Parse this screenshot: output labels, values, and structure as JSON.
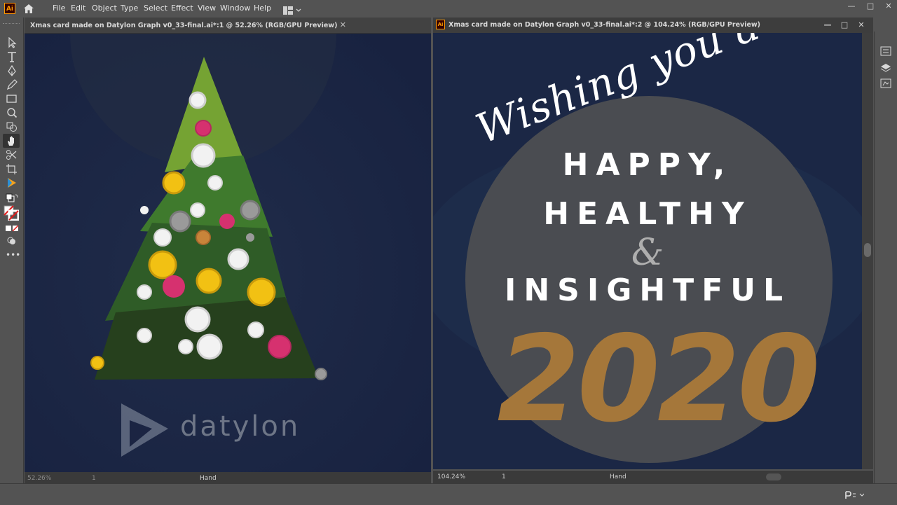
{
  "app": {
    "logo_text": "Ai"
  },
  "menu": [
    "File",
    "Edit",
    "Object",
    "Type",
    "Select",
    "Effect",
    "View",
    "Window",
    "Help"
  ],
  "window_controls": {
    "minimize": "—",
    "maximize": "□",
    "close": "✕"
  },
  "doc_left": {
    "tab_title": "Xmas card made on Datylon Graph v0_33-final.ai*:1 @ 52.26% (RGB/GPU Preview)",
    "close": "✕",
    "zoom": "52.26%",
    "page": "1",
    "tool_status": "Hand",
    "logo_word": "datylon"
  },
  "doc_right": {
    "tab_title": "Xmas card made on Datylon Graph v0_33-final.ai*:2 @ 104.24% (RGB/GPU Preview)",
    "zoom": "104.24%",
    "page": "1",
    "tool_status": "Hand",
    "script_line": "Wishing you a",
    "line1": "HAPPY,",
    "line2": "HEALTHY",
    "ampersand": "&",
    "line3": "INSIGHTFUL",
    "year": "2020"
  },
  "colors": {
    "canvas_bg": "#1a2440",
    "ui_bg": "#535353",
    "tree_light": "#75a333",
    "tree_mid": "#3f7a2d",
    "tree_dark": "#2f5c27",
    "tree_darkest": "#26401d",
    "ornament_yellow": "#f2c113",
    "ornament_pink": "#d6316f",
    "ornament_white": "#f2f2f2",
    "ornament_grey": "#9a9a9a",
    "ornament_orange": "#c8843a",
    "year_gold": "#a5773a",
    "circle_grey": "#4a4c51"
  }
}
